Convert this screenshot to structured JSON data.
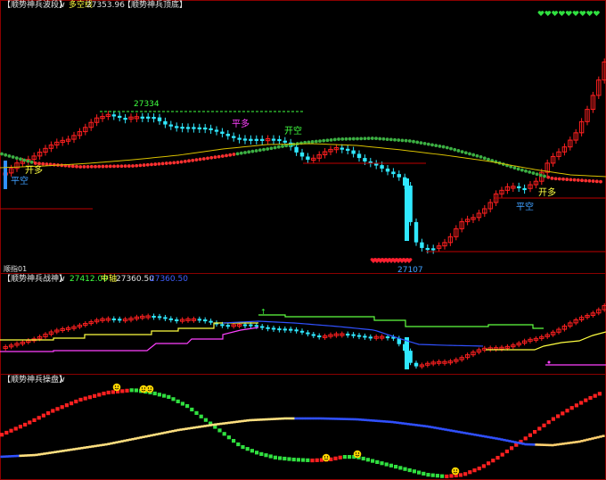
{
  "colors": {
    "background": "#000000",
    "frame": "#8b0000",
    "up": "#ff2020",
    "down": "#30e8ff",
    "dot_green": "#3cb043",
    "dot_red": "#ff3030",
    "yellow": "#ffff40",
    "magenta": "#ff40ff",
    "blue": "#3050ff",
    "green_line": "#60ff40",
    "heart": "#ff2030",
    "heart_green": "#30e040",
    "smiley": "#ffd700"
  },
  "panel1": {
    "title": "【顺势神兵波段】",
    "dropdown": "∨",
    "label1": "多空线",
    "value1": "27353.96",
    "title2": "【顺势神兵顶底】",
    "high_label": "27334",
    "low_label": "27107",
    "signals": {
      "open_long_1": "开多",
      "close_short_1": "平空",
      "close_long": "平多",
      "open_short": "开空",
      "open_long_2": "开多",
      "close_short_2": "平空"
    },
    "corner_text": "顺指01"
  },
  "panel2": {
    "title": "【顺势神兵战神】",
    "dropdown": "∨",
    "value1": "27412.00",
    "label2": "中轴",
    "value2": "27360.50",
    "value3": "27360.50"
  },
  "panel3": {
    "title": "【顺势神兵操盘】",
    "dropdown": "∨"
  },
  "chart_data": [
    {
      "type": "candlestick",
      "title": "【顺势神兵波段】",
      "series": [
        {
          "name": "多空线",
          "last": 27353.96
        }
      ],
      "annotations": [
        {
          "text": "27334",
          "kind": "high"
        },
        {
          "text": "27107",
          "kind": "low"
        },
        {
          "text": "开多"
        },
        {
          "text": "平空"
        },
        {
          "text": "平多"
        },
        {
          "text": "开空"
        }
      ]
    },
    {
      "type": "candlestick",
      "title": "【顺势神兵战神】",
      "series": [
        {
          "name": "",
          "last": 27412.0
        },
        {
          "name": "中轴",
          "last": 27360.5
        }
      ]
    },
    {
      "type": "line",
      "title": "【顺势神兵操盘】",
      "series": [
        {
          "name": "",
          "description_colors": [
            "#ff2020",
            "#30e040"
          ]
        },
        {
          "name": "",
          "description_colors": [
            "#ffff40",
            "#3050ff"
          ]
        }
      ]
    }
  ]
}
